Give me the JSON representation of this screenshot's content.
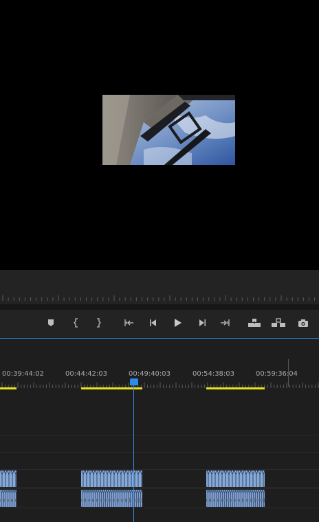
{
  "timeline": {
    "timecodes": [
      "00:39:44:02",
      "00:44:42:03",
      "00:49:40:03",
      "00:54:38:03",
      "00:59:36:04"
    ]
  },
  "transport": {
    "buttons": [
      {
        "name": "add-marker-button",
        "icon": "marker-icon"
      },
      {
        "name": "mark-in-button",
        "icon": "mark-in-icon"
      },
      {
        "name": "mark-out-button",
        "icon": "mark-out-icon"
      },
      {
        "name": "go-to-in-button",
        "icon": "go-to-in-icon"
      },
      {
        "name": "step-back-button",
        "icon": "step-back-icon"
      },
      {
        "name": "play-button",
        "icon": "play-icon"
      },
      {
        "name": "step-forward-button",
        "icon": "step-forward-icon"
      },
      {
        "name": "go-to-out-button",
        "icon": "go-to-out-icon"
      },
      {
        "name": "lift-button",
        "icon": "lift-icon"
      },
      {
        "name": "extract-button",
        "icon": "extract-icon"
      },
      {
        "name": "export-frame-button",
        "icon": "camera-icon"
      }
    ]
  },
  "colors": {
    "accent": "#2d8ceb",
    "workarea": "#e8e21c",
    "video_clip": "#86a9d8",
    "panel": "#232323"
  }
}
